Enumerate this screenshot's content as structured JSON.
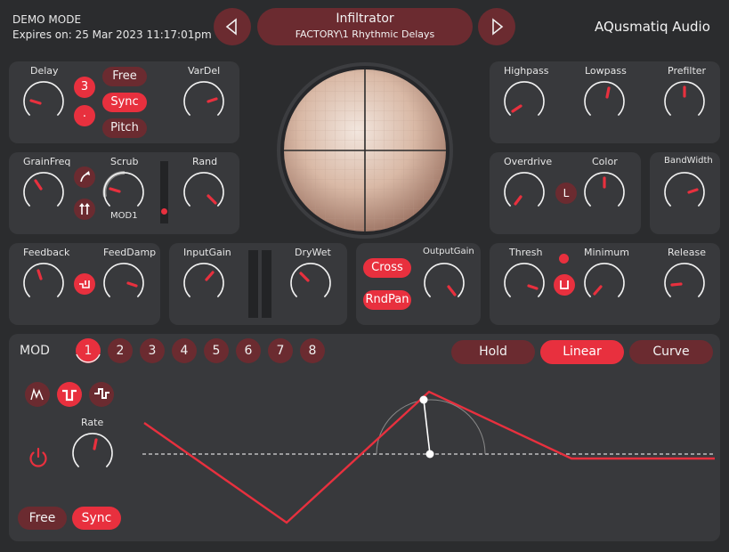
{
  "header": {
    "demo_mode": "DEMO MODE",
    "expires": "Expires on: 25 Mar 2023 11:17:01pm",
    "preset_name": "Infiltrator",
    "preset_path": "FACTORY\\1 Rhythmic Delays",
    "brand": "AQusmatiq Audio"
  },
  "delay_panel": {
    "delay_label": "Delay",
    "vardel_label": "VarDel",
    "numerator": "3",
    "dot": ".",
    "free": "Free",
    "sync": "Sync",
    "pitch": "Pitch"
  },
  "grain_panel": {
    "grainfreq_label": "GrainFreq",
    "scrub_label": "Scrub",
    "rand_label": "Rand",
    "mod_tag": "MOD1"
  },
  "feedback_panel": {
    "feedback_label": "Feedback",
    "feeddamp_label": "FeedDamp"
  },
  "gain_panel": {
    "inputgain_label": "InputGain",
    "drywet_label": "DryWet"
  },
  "output_panel": {
    "cross": "Cross",
    "rndpan": "RndPan",
    "outputgain_label": "OutputGain"
  },
  "filter_panel": {
    "highpass_label": "Highpass",
    "lowpass_label": "Lowpass",
    "prefilter_label": "Prefilter"
  },
  "drive_panel": {
    "overdrive_label": "Overdrive",
    "color_label": "Color",
    "l_button": "L",
    "bandwidth_label": "BandWidth"
  },
  "gate_panel": {
    "thresh_label": "Thresh",
    "minimum_label": "Minimum",
    "release_label": "Release"
  },
  "mod": {
    "title": "MOD",
    "slots": [
      "1",
      "2",
      "3",
      "4",
      "5",
      "6",
      "7",
      "8"
    ],
    "active_slot": "1",
    "shapes": [
      "Hold",
      "Linear",
      "Curve"
    ],
    "active_shape": "Linear",
    "rate_label": "Rate",
    "free": "Free",
    "sync": "Sync"
  },
  "colors": {
    "accent": "#e8303e",
    "accent_dark": "#6b2b30",
    "panel": "#38393c",
    "background": "#2b2c2e"
  },
  "icons": {
    "prev": "triangle-left-icon",
    "next": "triangle-right-icon",
    "power": "power-icon"
  }
}
